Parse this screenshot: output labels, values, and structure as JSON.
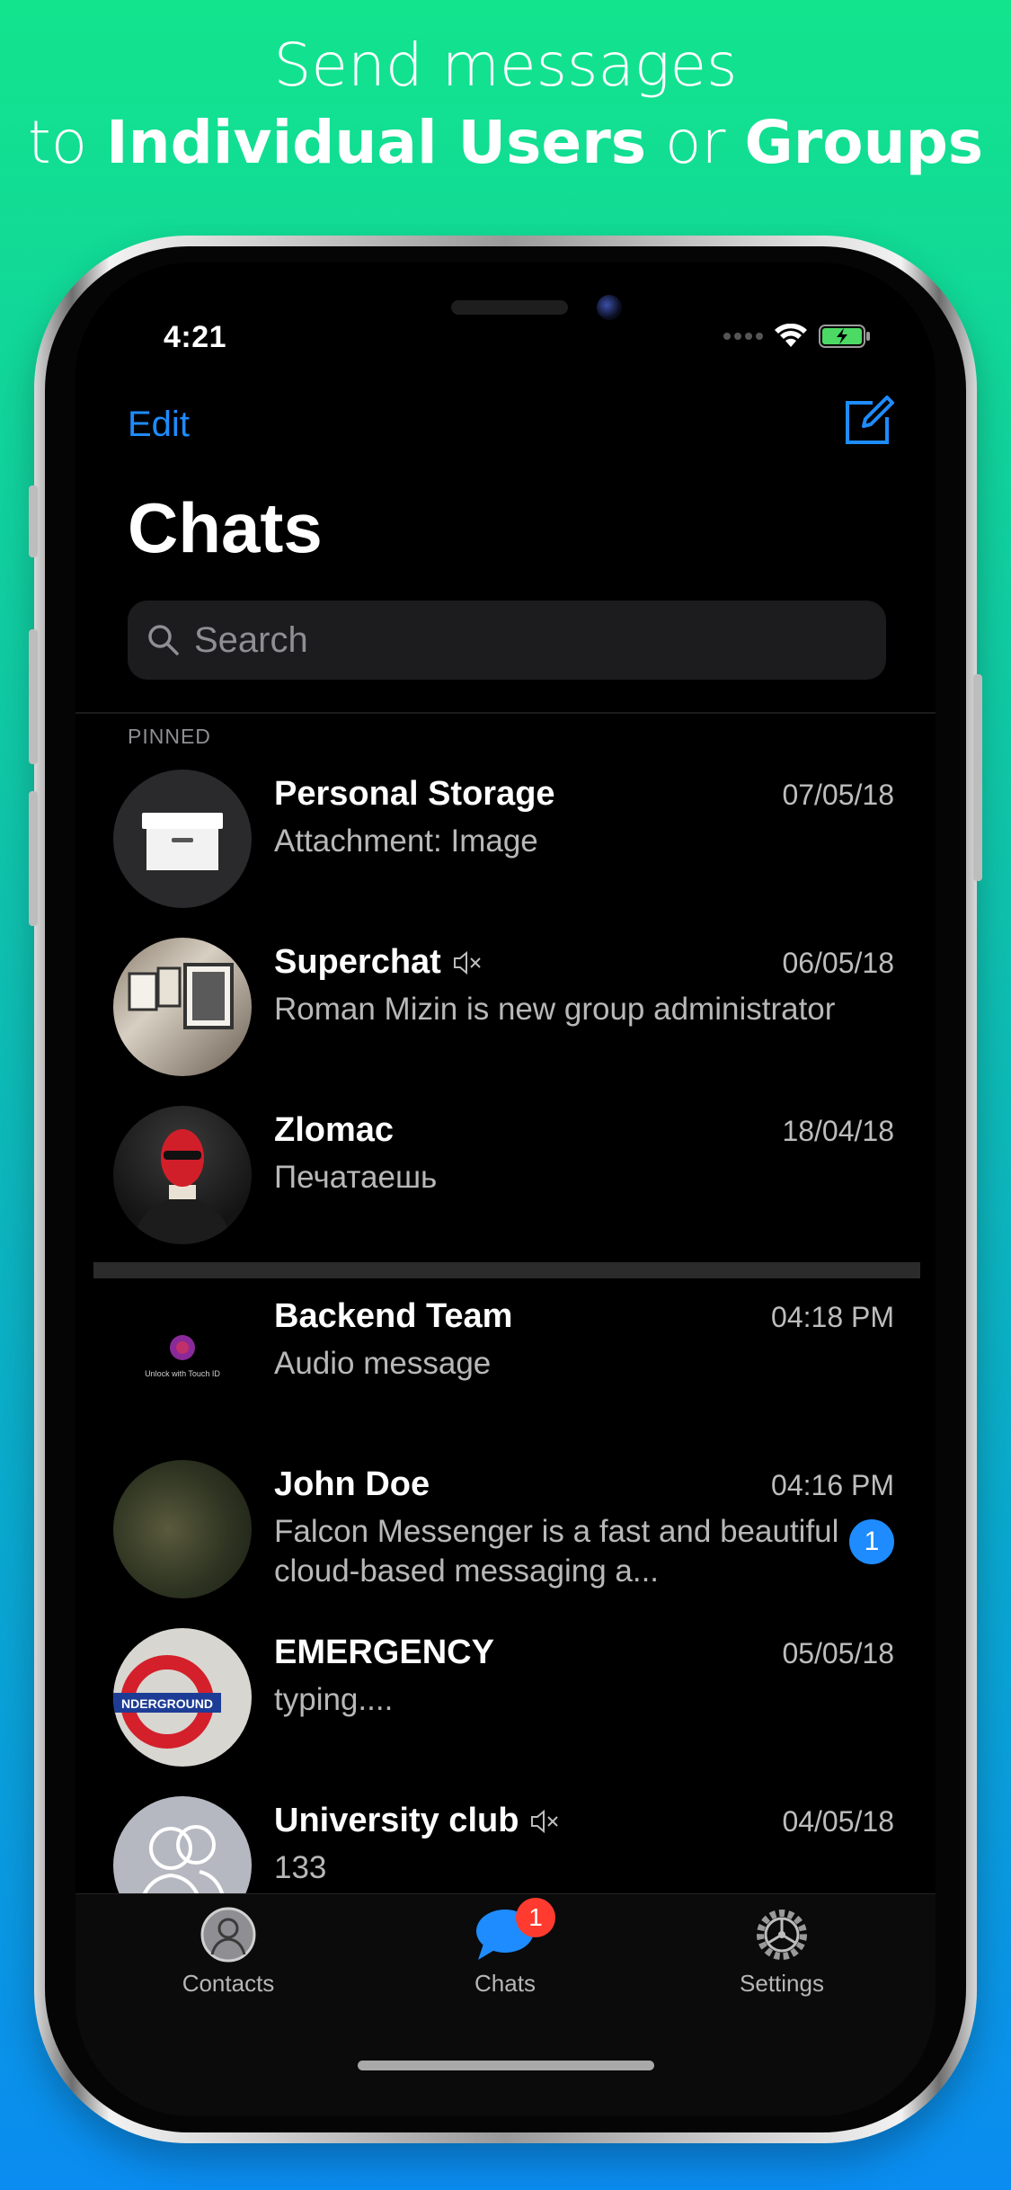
{
  "headline": {
    "line1": "Send messages",
    "line2_pre": "to ",
    "line2_bold1": "Individual Users",
    "line2_mid": " or ",
    "line2_bold2": "Groups"
  },
  "status_bar": {
    "time": "4:21"
  },
  "nav": {
    "edit_label": "Edit",
    "title": "Chats"
  },
  "search": {
    "placeholder": "Search",
    "value": ""
  },
  "sections": {
    "pinned_label": "PINNED"
  },
  "pinned": [
    {
      "name": "Personal Storage",
      "date": "07/05/18",
      "preview": "Attachment: Image",
      "muted": false
    },
    {
      "name": "Superchat",
      "date": "06/05/18",
      "preview": "Roman Mizin is new group administrator",
      "muted": true
    },
    {
      "name": "Zlomac",
      "date": "18/04/18",
      "preview": "Печатаешь",
      "muted": false
    }
  ],
  "chats": [
    {
      "name": "Backend Team",
      "date": "04:18 PM",
      "preview": "Audio message",
      "muted": false,
      "avatar_caption": "Unlock with Touch ID"
    },
    {
      "name": "John Doe",
      "date": "04:16 PM",
      "preview": "Falcon Messenger is a fast and beautiful cloud-based messaging a...",
      "muted": false,
      "unread": "1"
    },
    {
      "name": "EMERGENCY",
      "date": "05/05/18",
      "preview": "typing....",
      "muted": false,
      "avatar_caption": "NDERGROUND"
    },
    {
      "name": "University club",
      "date": "04/05/18",
      "preview": "133",
      "muted": true
    }
  ],
  "tabbar": {
    "contacts_label": "Contacts",
    "chats_label": "Chats",
    "chats_badge": "1",
    "settings_label": "Settings"
  },
  "colors": {
    "accent": "#1e8cff",
    "badge": "#ff3b30",
    "background": "#000000"
  }
}
